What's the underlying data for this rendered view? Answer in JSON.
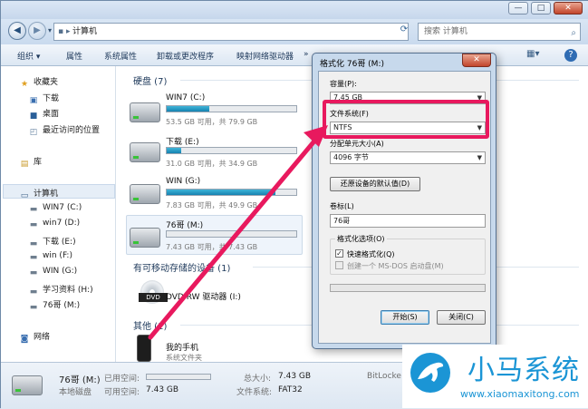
{
  "window": {
    "address": "计算机",
    "search_placeholder": "搜索 计算机",
    "controls": {
      "min": "—",
      "max": "□",
      "close": "✕"
    },
    "nav": {
      "back": "◀",
      "forward": "▶",
      "dropdown": "▾",
      "refresh": "⟳"
    },
    "search_icon": "magnifier-icon"
  },
  "toolbar": {
    "organize": "组织 ▾",
    "properties": "属性",
    "system_properties": "系统属性",
    "uninstall": "卸载或更改程序",
    "map_drive": "映射网络驱动器",
    "more": "»",
    "view_icon": "view-icon",
    "help_icon": "help-icon"
  },
  "sidebar": {
    "favorites": "收藏夹",
    "downloads": "下载",
    "desktop": "桌面",
    "recent": "最近访问的位置",
    "library": "库",
    "computer": "计算机",
    "drives": [
      "WIN7 (C:)",
      "win7 (D:)",
      "下载 (E:)",
      "win (F:)",
      "WIN (G:)",
      "学习资料 (H:)",
      "76哥 (M:)"
    ],
    "network": "网络"
  },
  "main": {
    "hard_disks_header": "硬盘 (7)",
    "removable_header": "有可移动存储的设备 (1)",
    "other_header": "其他 (1)",
    "drives": [
      {
        "name": "WIN7 (C:)",
        "info": "53.5 GB 可用，共 79.9 GB",
        "used_fraction": 0.33
      },
      {
        "name": "下载 (E:)",
        "info": "31.0 GB 可用，共 34.9 GB",
        "used_fraction": 0.11
      },
      {
        "name": "WIN (G:)",
        "info": "7.83 GB 可用，共 49.9 GB",
        "used_fraction": 0.84
      },
      {
        "name": "76哥 (M:)",
        "info": "7.43 GB 可用，共 7.43 GB",
        "used_fraction": 0.0
      }
    ],
    "dvd": {
      "name": "DVD RW 驱动器 (I:)",
      "label": "DVD"
    },
    "phone": {
      "name": "我的手机",
      "desc": "系统文件夹"
    }
  },
  "status": {
    "drive_name": "76哥 (M:)",
    "drive_type": "本地磁盘",
    "used_label": "已用空间:",
    "free_label": "可用空间:",
    "free_value": "7.43 GB",
    "total_label": "总大小:",
    "total_value": "7.43 GB",
    "fs_label": "文件系统:",
    "fs_value": "FAT32",
    "bitlocker": "BitLocke"
  },
  "dialog": {
    "title": "格式化 76哥 (M:)",
    "close": "✕",
    "capacity_label": "容量(P):",
    "capacity_value": "7.45 GB",
    "fs_label": "文件系统(F)",
    "fs_value": "NTFS",
    "alloc_label": "分配单元大小(A)",
    "alloc_value": "4096 字节",
    "restore_button": "还原设备的默认值(D)",
    "volume_label": "卷标(L)",
    "volume_value": "76哥",
    "options_label": "格式化选项(O)",
    "quick_format": "快速格式化(Q)",
    "quick_checked": "✓",
    "msdos": "创建一个 MS-DOS 启动盘(M)",
    "start_button": "开始(S)",
    "close_button": "关闭(C)"
  },
  "colors": {
    "highlight": "#e8195e",
    "bar_fill": "#1582b0",
    "brand": "#1b95d5"
  },
  "watermark": {
    "brand": "小马系统",
    "url": "www.xiaomaxitong.com"
  }
}
